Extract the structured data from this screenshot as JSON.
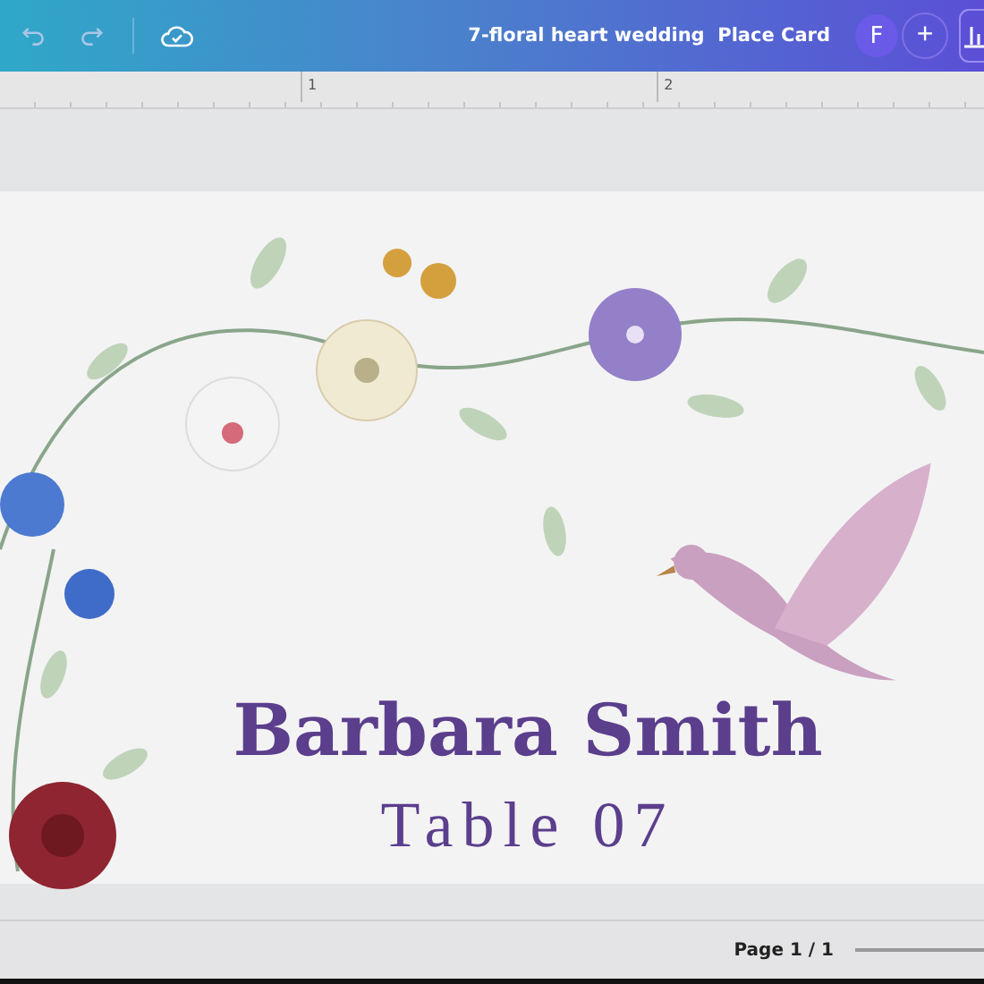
{
  "document_title": "7-floral heart wedding  Place Card",
  "avatar": {
    "initial": "F"
  },
  "add_button": {
    "label": "+"
  },
  "ruler": {
    "marks": [
      "1",
      "2"
    ]
  },
  "card": {
    "name": "Barbara Smith",
    "table": "Table 07"
  },
  "footer": {
    "page_indicator": "Page 1 / 1"
  }
}
